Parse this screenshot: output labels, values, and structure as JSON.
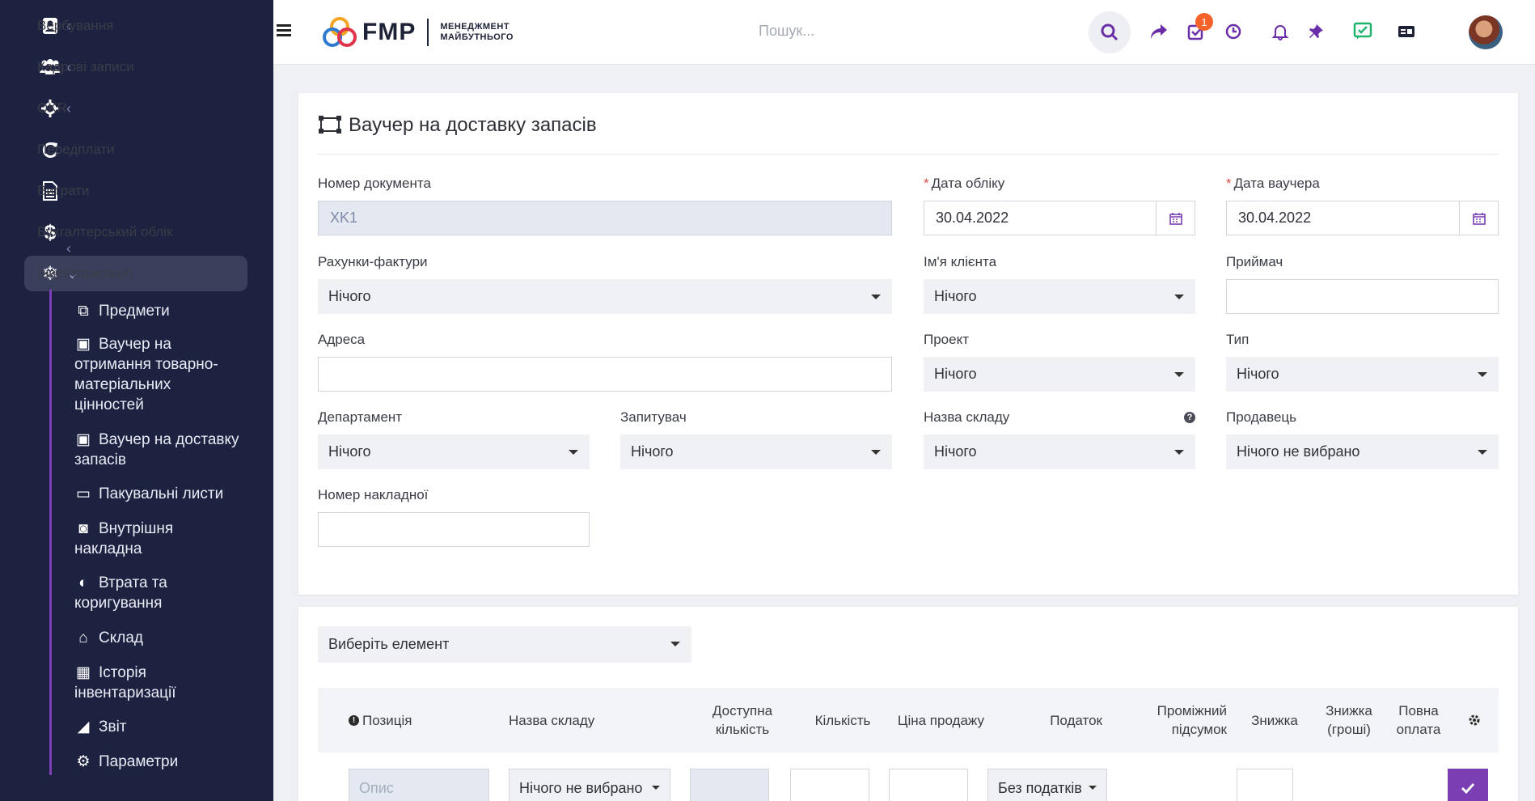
{
  "sidebar": {
    "items": [
      {
        "label": "Вербування",
        "icon": "user-tie-icon",
        "chevron": "‹"
      },
      {
        "label": "Кадрові записи",
        "icon": "users-icon",
        "chevron": "‹"
      },
      {
        "label": "OKR",
        "icon": "crosshair-icon",
        "chevron": "‹"
      },
      {
        "label": "Передплати",
        "icon": "refresh-icon",
        "chevron": ""
      },
      {
        "label": "Витрати",
        "icon": "file-icon",
        "chevron": ""
      },
      {
        "label": "Бухгалтерський облік",
        "icon": "dollar-icon",
        "chevron": "‹"
      },
      {
        "label": "Інвентаризація",
        "icon": "snowflake-icon",
        "chevron": "⌄"
      }
    ],
    "subitems": [
      {
        "label": "Предмети",
        "icon": "copy-icon"
      },
      {
        "label": "Ваучер на отримання товарно-матеріальних цінностей",
        "icon": "voucher-receive-icon"
      },
      {
        "label": "Ваучер на доставку запасів",
        "icon": "voucher-delivery-icon"
      },
      {
        "label": "Пакувальні листи",
        "icon": "inbox-icon"
      },
      {
        "label": "Внутрішня накладна",
        "icon": "rss-icon"
      },
      {
        "label": "Втрата та коригування",
        "icon": "half-circle-icon"
      },
      {
        "label": "Склад",
        "icon": "home-icon"
      },
      {
        "label": "Історія інвентаризації",
        "icon": "calendar-icon"
      },
      {
        "label": "Звіт",
        "icon": "chart-icon"
      },
      {
        "label": "Параметри",
        "icon": "cogs-icon"
      }
    ]
  },
  "topbar": {
    "logo_text": "FMP",
    "logo_sub_line1": "МЕНЕДЖМЕНТ",
    "logo_sub_line2": "МАЙБУТНЬОГО",
    "search_placeholder": "Пошук...",
    "tasks_badge": "1"
  },
  "form": {
    "title": "Ваучер на доставку запасів",
    "doc_number_label": "Номер документа",
    "doc_number_value": "XK1",
    "accounting_date_label": "Дата обліку",
    "accounting_date_value": "30.04.2022",
    "voucher_date_label": "Дата ваучера",
    "voucher_date_value": "30.04.2022",
    "invoices_label": "Рахунки-фактури",
    "invoices_value": "Нічого",
    "client_name_label": "Ім'я клієнта",
    "client_name_value": "Нічого",
    "receiver_label": "Приймач",
    "address_label": "Адреса",
    "project_label": "Проект",
    "project_value": "Нічого",
    "type_label": "Тип",
    "type_value": "Нічого",
    "department_label": "Департамент",
    "department_value": "Нічого",
    "requester_label": "Запитувач",
    "requester_value": "Нічого",
    "warehouse_label": "Назва складу",
    "warehouse_value": "Нічого",
    "seller_label": "Продавець",
    "seller_value": "Нічого не вибрано",
    "invoice_number_label": "Номер накладної",
    "required_mark": "*",
    "help_mark": "?"
  },
  "items": {
    "select_placeholder": "Виберіть елемент",
    "headers": {
      "position": "Позиція",
      "warehouse": "Назва складу",
      "available_qty": "Доступна кількість",
      "quantity": "Кількість",
      "sale_price": "Ціна продажу",
      "tax": "Податок",
      "subtotal": "Проміжний підсумок",
      "discount": "Знижка",
      "discount_money": "Знижка (гроші)",
      "total": "Повна оплата"
    },
    "row": {
      "description_placeholder": "Опис",
      "warehouse_value": "Нічого не вибрано",
      "tax_value": "Без податків"
    }
  },
  "colors": {
    "sidebar_bg": "#1d2240",
    "accent": "#7b3fb3",
    "badge": "#f5622a"
  }
}
